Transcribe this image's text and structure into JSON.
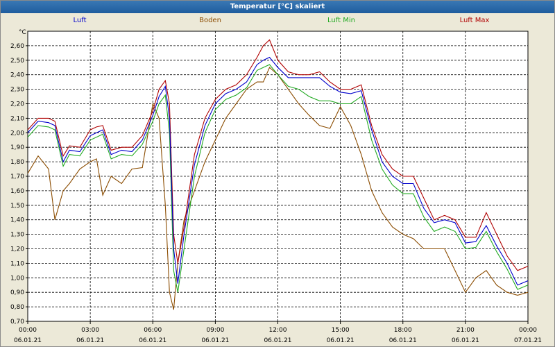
{
  "window": {
    "title": "Temperatur [°C] skaliert"
  },
  "colors": {
    "Luft": "#0000cc",
    "Boden": "#8b4c00",
    "Luft Min": "#22aa22",
    "Luft Max": "#b00000",
    "background": "#ece9d8",
    "grid": "#000000"
  },
  "chart_data": {
    "type": "line",
    "title": "Temperatur [°C] skaliert",
    "ylabel": "°C",
    "xlabel": "",
    "ylim": [
      0.7,
      2.7
    ],
    "xlim": [
      0,
      24
    ],
    "grid": true,
    "legend_position": "top",
    "y_ticks": [
      "0,70",
      "0,80",
      "0,90",
      "1,00",
      "1,10",
      "1,20",
      "1,30",
      "1,40",
      "1,50",
      "1,60",
      "1,70",
      "1,80",
      "1,90",
      "2,00",
      "2,10",
      "2,20",
      "2,30",
      "2,40",
      "2,50",
      "2,60"
    ],
    "x_ticks": [
      {
        "time": "00:00",
        "date": "06.01.21"
      },
      {
        "time": "03:00",
        "date": "06.01.21"
      },
      {
        "time": "06:00",
        "date": "06.01.21"
      },
      {
        "time": "09:00",
        "date": "06.01.21"
      },
      {
        "time": "12:00",
        "date": "06.01.21"
      },
      {
        "time": "15:00",
        "date": "06.01.21"
      },
      {
        "time": "18:00",
        "date": "06.01.21"
      },
      {
        "time": "21:00",
        "date": "06.01.21"
      },
      {
        "time": "00:00",
        "date": "07.01.21"
      }
    ],
    "x_hours": [
      0,
      0.5,
      1,
      1.3,
      1.7,
      2,
      2.5,
      3,
      3.3,
      3.6,
      4,
      4.5,
      5,
      5.5,
      6,
      6.3,
      6.6,
      6.8,
      7,
      7.2,
      7.5,
      8,
      8.5,
      9,
      9.5,
      10,
      10.5,
      11,
      11.3,
      11.6,
      12,
      12.5,
      13,
      13.5,
      14,
      14.5,
      15,
      15.5,
      16,
      16.5,
      17,
      17.5,
      18,
      18.5,
      19,
      19.5,
      20,
      20.5,
      21,
      21.5,
      22,
      22.5,
      23,
      23.5,
      24
    ],
    "series": [
      {
        "name": "Luft",
        "values": [
          2.0,
          2.08,
          2.07,
          2.05,
          1.8,
          1.88,
          1.87,
          1.98,
          2.0,
          2.02,
          1.85,
          1.88,
          1.87,
          1.95,
          2.12,
          2.25,
          2.32,
          2.1,
          1.2,
          0.96,
          1.3,
          1.78,
          2.05,
          2.2,
          2.27,
          2.3,
          2.35,
          2.47,
          2.5,
          2.52,
          2.45,
          2.38,
          2.38,
          2.38,
          2.38,
          2.32,
          2.28,
          2.27,
          2.29,
          2.02,
          1.8,
          1.7,
          1.65,
          1.65,
          1.48,
          1.38,
          1.4,
          1.38,
          1.24,
          1.25,
          1.36,
          1.22,
          1.1,
          0.95,
          0.98
        ]
      },
      {
        "name": "Boden",
        "values": [
          1.72,
          1.84,
          1.75,
          1.4,
          1.6,
          1.65,
          1.75,
          1.8,
          1.82,
          1.57,
          1.7,
          1.65,
          1.75,
          1.76,
          2.2,
          2.1,
          1.5,
          0.9,
          0.78,
          1.1,
          1.4,
          1.6,
          1.8,
          1.95,
          2.1,
          2.2,
          2.3,
          2.35,
          2.35,
          2.45,
          2.4,
          2.3,
          2.2,
          2.12,
          2.05,
          2.03,
          2.18,
          2.05,
          1.85,
          1.6,
          1.45,
          1.35,
          1.3,
          1.27,
          1.2,
          1.2,
          1.2,
          1.05,
          0.9,
          1.0,
          1.05,
          0.95,
          0.9,
          0.88,
          0.9
        ]
      },
      {
        "name": "Luft Min",
        "values": [
          1.97,
          2.05,
          2.04,
          2.02,
          1.77,
          1.85,
          1.84,
          1.95,
          1.97,
          1.99,
          1.82,
          1.85,
          1.84,
          1.92,
          2.08,
          2.2,
          2.26,
          2.0,
          1.05,
          0.9,
          1.2,
          1.7,
          2.0,
          2.16,
          2.23,
          2.26,
          2.31,
          2.43,
          2.45,
          2.47,
          2.4,
          2.32,
          2.3,
          2.25,
          2.22,
          2.22,
          2.2,
          2.2,
          2.25,
          1.95,
          1.75,
          1.64,
          1.58,
          1.58,
          1.42,
          1.32,
          1.35,
          1.32,
          1.2,
          1.21,
          1.32,
          1.18,
          1.06,
          0.92,
          0.95
        ]
      },
      {
        "name": "Luft Max",
        "values": [
          2.02,
          2.1,
          2.1,
          2.08,
          1.84,
          1.91,
          1.9,
          2.02,
          2.04,
          2.05,
          1.88,
          1.9,
          1.9,
          1.98,
          2.15,
          2.3,
          2.36,
          2.2,
          1.3,
          1.1,
          1.35,
          1.85,
          2.1,
          2.23,
          2.3,
          2.33,
          2.4,
          2.52,
          2.6,
          2.64,
          2.5,
          2.42,
          2.4,
          2.4,
          2.42,
          2.35,
          2.3,
          2.3,
          2.33,
          2.05,
          1.85,
          1.75,
          1.7,
          1.7,
          1.55,
          1.4,
          1.43,
          1.4,
          1.28,
          1.28,
          1.45,
          1.3,
          1.15,
          1.05,
          1.08
        ]
      }
    ]
  }
}
